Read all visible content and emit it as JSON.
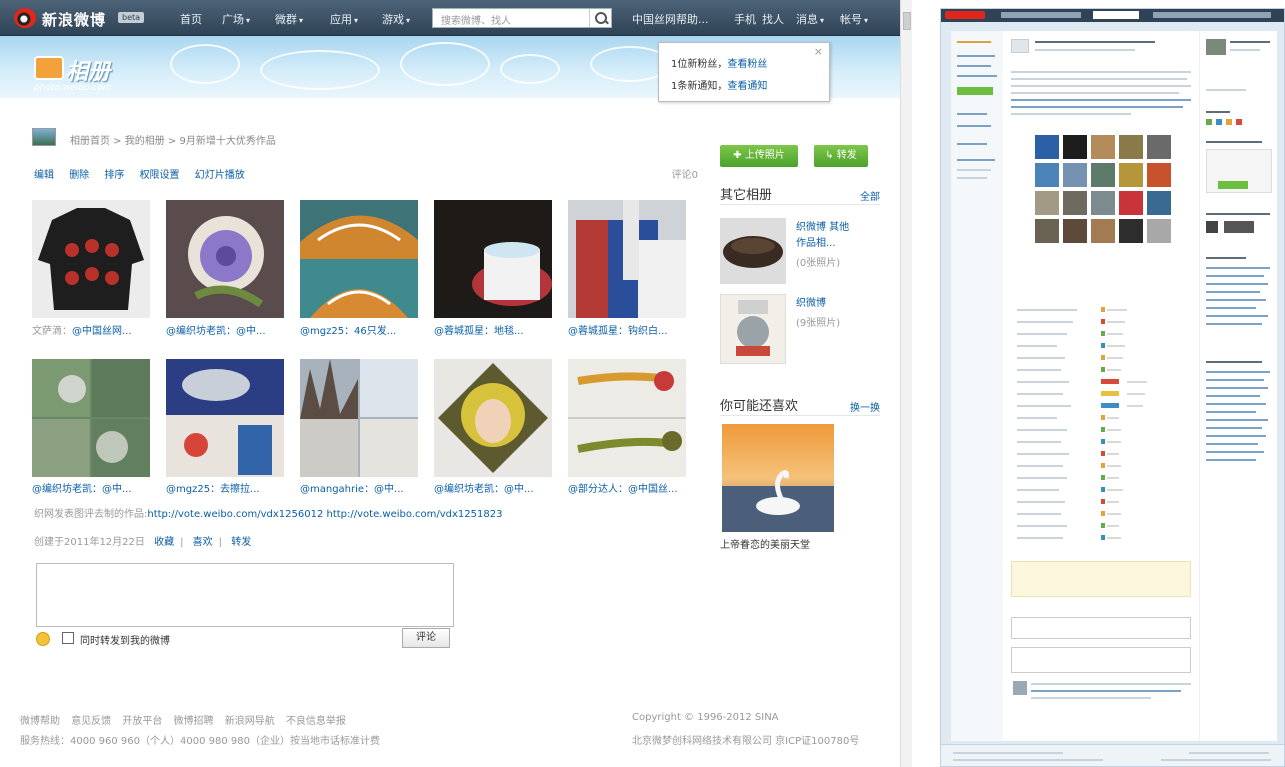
{
  "app": {
    "name": "新浪微博",
    "beta": "beta"
  },
  "nav": {
    "items": [
      {
        "label": "首页",
        "caret": false
      },
      {
        "label": "广场",
        "caret": true
      },
      {
        "label": "微群",
        "caret": true
      },
      {
        "label": "应用",
        "caret": true
      },
      {
        "label": "游戏",
        "caret": true
      }
    ],
    "search_placeholder": "搜索微博、找人",
    "right_items": [
      {
        "label": "中国丝网帮助..."
      },
      {
        "label": "手机"
      },
      {
        "label": "找人"
      },
      {
        "label": "消息",
        "caret": true
      },
      {
        "label": "帐号",
        "caret": true
      }
    ]
  },
  "banner": {
    "title": "相册",
    "subtitle": "photo.weibo.com"
  },
  "notice": {
    "line1_prefix": "1位新粉丝，",
    "line1_link": "查看粉丝",
    "line2_prefix": "1条新通知，",
    "line2_link": "查看通知",
    "close": "×"
  },
  "breadcrumb": "相册首页 > 我的相册 > 9月新增十大优秀作品",
  "toolbar": {
    "items": [
      "编辑",
      "删除",
      "排序",
      "权限设置",
      "幻灯片播放"
    ],
    "comments": "评论0"
  },
  "photos": [
    {
      "prefix": "文萨滴：",
      "link": "@中国丝网...",
      "bg": "#2b2a2a",
      "accent": "#b8312a"
    },
    {
      "prefix": "",
      "link": "@编织坊老凯：@中...",
      "bg": "#4d4446",
      "accent": "#8c78c8"
    },
    {
      "prefix": "",
      "link": "@mgz25：46只发...",
      "bg": "#3e7378",
      "accent": "#d0862f"
    },
    {
      "prefix": "",
      "link": "@蓉城孤星：地毯...",
      "bg": "#1d1a17",
      "accent": "#b4343c"
    },
    {
      "prefix": "",
      "link": "@蓉城孤星：钩织白...",
      "bg": "#cfd3d8",
      "accent": "#2a4e9a"
    },
    {
      "prefix": "",
      "link": "@编织坊老凯：@中...",
      "bg": "#6a8868",
      "accent": "#cfd4cd"
    },
    {
      "prefix": "",
      "link": "@mgz25：去擦拉...",
      "bg": "#2b3e84",
      "accent": "#e8e3dc"
    },
    {
      "prefix": "",
      "link": "@mangahrie：@中...",
      "bg": "#a7b2bc",
      "accent": "#e5e3de"
    },
    {
      "prefix": "",
      "link": "@编织坊老凯：@中...",
      "bg": "#e9e7e4",
      "accent": "#d6c23b"
    },
    {
      "prefix": "",
      "link": "@部分达人：@中国丝...",
      "bg": "#ecebe6",
      "accent": "#c63a3a"
    }
  ],
  "source_text": {
    "prefix": "织网发表图评去制的作品:",
    "link": "http://vote.weibo.com/vdx1256012 http://vote.weibo.com/vdx1251823"
  },
  "meta": {
    "date": "创建于2011年12月22日",
    "links": [
      "收藏",
      "喜欢",
      "转发"
    ]
  },
  "compose": {
    "checkbox_label": "同时转发到我的微博",
    "submit": "评论"
  },
  "side": {
    "upload_btn": "✚ 上传照片",
    "share_btn": "↳ 转发",
    "other_albums_title": "其它相册",
    "all": "全部",
    "album1_title": "织微博 其他作品相...",
    "album1_count": "(0张照片)",
    "album2_title": "织微博",
    "album2_count": "(9张照片)",
    "maybe_title": "你可能还喜欢",
    "refresh": "换一换",
    "rec_caption": "上帝眷恋的美丽天堂"
  },
  "footer": {
    "links": [
      "微博帮助",
      "意见反馈",
      "开放平台",
      "微博招聘",
      "新浪网导航",
      "不良信息举报"
    ],
    "hotline": "服务热线：4000 960 960（个人）4000 980 980（企业）按当地市话标准计费",
    "copyright": "Copyright © 1996-2012 SINA",
    "company": "北京微梦创科网络技术有限公司 京ICP证100780号"
  }
}
